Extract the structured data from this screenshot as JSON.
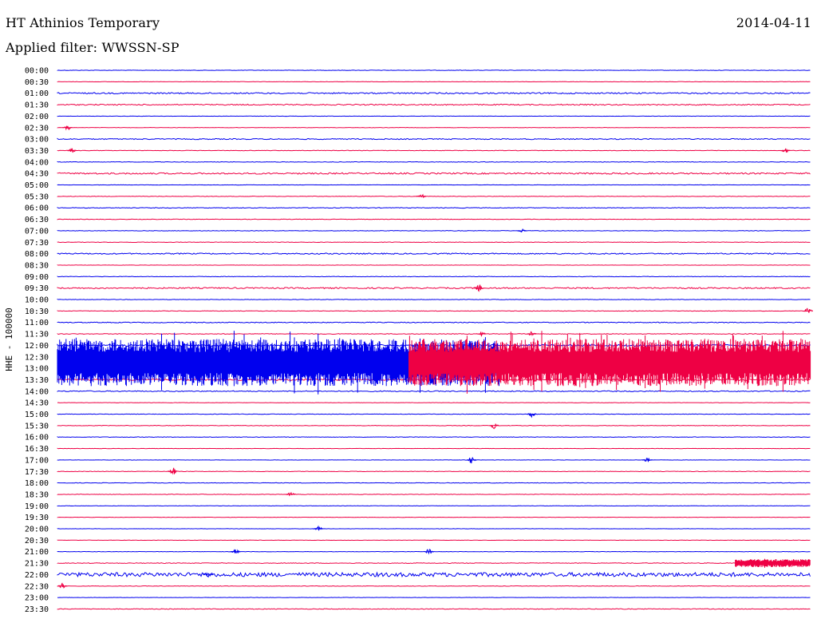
{
  "header": {
    "station": "HT Athinios Temporary",
    "date": "2014-04-11",
    "filter": "Applied filter: WWSSN-SP"
  },
  "chart_data": {
    "type": "line",
    "title": "HT Athinios Temporary",
    "ylabel": "HHE - 100000",
    "xlim_minutes": [
      0,
      30
    ],
    "grid": false,
    "colors": [
      "#0000ee",
      "#ee0044"
    ],
    "row_labels": [
      "00:00",
      "00:30",
      "01:00",
      "01:30",
      "02:00",
      "02:30",
      "03:00",
      "03:30",
      "04:00",
      "04:30",
      "05:00",
      "05:30",
      "06:00",
      "06:30",
      "07:00",
      "07:30",
      "08:00",
      "08:30",
      "09:00",
      "09:30",
      "10:00",
      "10:30",
      "11:00",
      "11:30",
      "12:00",
      "12:30",
      "13:00",
      "13:30",
      "14:00",
      "14:30",
      "15:00",
      "15:30",
      "16:00",
      "16:30",
      "17:00",
      "17:30",
      "18:00",
      "18:30",
      "19:00",
      "19:30",
      "20:00",
      "20:30",
      "21:00",
      "21:30",
      "22:00",
      "22:30",
      "23:00",
      "23:30"
    ],
    "row_noise": [
      0.3,
      0.2,
      0.8,
      0.7,
      0.2,
      0.2,
      0.6,
      0.3,
      0.3,
      0.9,
      0.2,
      0.3,
      0.4,
      0.3,
      0.3,
      0.3,
      0.7,
      0.2,
      0.3,
      0.8,
      0.3,
      0.3,
      0.5,
      0.4,
      1.0,
      1.0,
      1.0,
      1.0,
      0.6,
      0.2,
      0.3,
      0.3,
      0.3,
      0.2,
      0.2,
      0.3,
      0.3,
      0.3,
      0.2,
      0.2,
      0.2,
      0.2,
      0.2,
      0.4,
      2.5,
      0.3,
      0.2,
      0.4
    ],
    "events": [
      {
        "row": 5,
        "minute": 0.4,
        "amp": 3
      },
      {
        "row": 7,
        "minute": 0.6,
        "amp": 3
      },
      {
        "row": 7,
        "minute": 29.0,
        "amp": 3
      },
      {
        "row": 11,
        "minute": 14.5,
        "amp": 3
      },
      {
        "row": 14,
        "minute": 18.5,
        "amp": 2
      },
      {
        "row": 19,
        "minute": 16.8,
        "amp": 4
      },
      {
        "row": 21,
        "minute": 29.9,
        "amp": 4
      },
      {
        "row": 23,
        "minute": 16.9,
        "amp": 3
      },
      {
        "row": 23,
        "minute": 18.9,
        "amp": 3
      },
      {
        "row": 24,
        "minute": 14.3,
        "amp": 4
      },
      {
        "row": 30,
        "minute": 18.9,
        "amp": 4
      },
      {
        "row": 31,
        "minute": 17.4,
        "amp": 4
      },
      {
        "row": 34,
        "minute": 16.5,
        "amp": 5
      },
      {
        "row": 34,
        "minute": 23.5,
        "amp": 3
      },
      {
        "row": 35,
        "minute": 4.6,
        "amp": 6
      },
      {
        "row": 37,
        "minute": 9.3,
        "amp": 3
      },
      {
        "row": 40,
        "minute": 10.4,
        "amp": 3
      },
      {
        "row": 42,
        "minute": 7.1,
        "amp": 3
      },
      {
        "row": 42,
        "minute": 14.8,
        "amp": 4
      },
      {
        "row": 44,
        "minute": 6.0,
        "amp": 4
      },
      {
        "row": 45,
        "minute": 0.2,
        "amp": 4
      }
    ],
    "bursts": [
      {
        "row_start": 24,
        "row_end": 27,
        "minute_start": 0,
        "minute_end": 17.6,
        "color": "#0000ee",
        "peak": 26
      },
      {
        "row_start": 24,
        "row_end": 27,
        "minute_start": 14.0,
        "minute_end": 30,
        "color": "#ee0044",
        "peak": 30
      },
      {
        "row_start": 43,
        "row_end": 43,
        "minute_start": 27.0,
        "minute_end": 30,
        "color": "#ee0044",
        "peak": 5
      }
    ]
  }
}
